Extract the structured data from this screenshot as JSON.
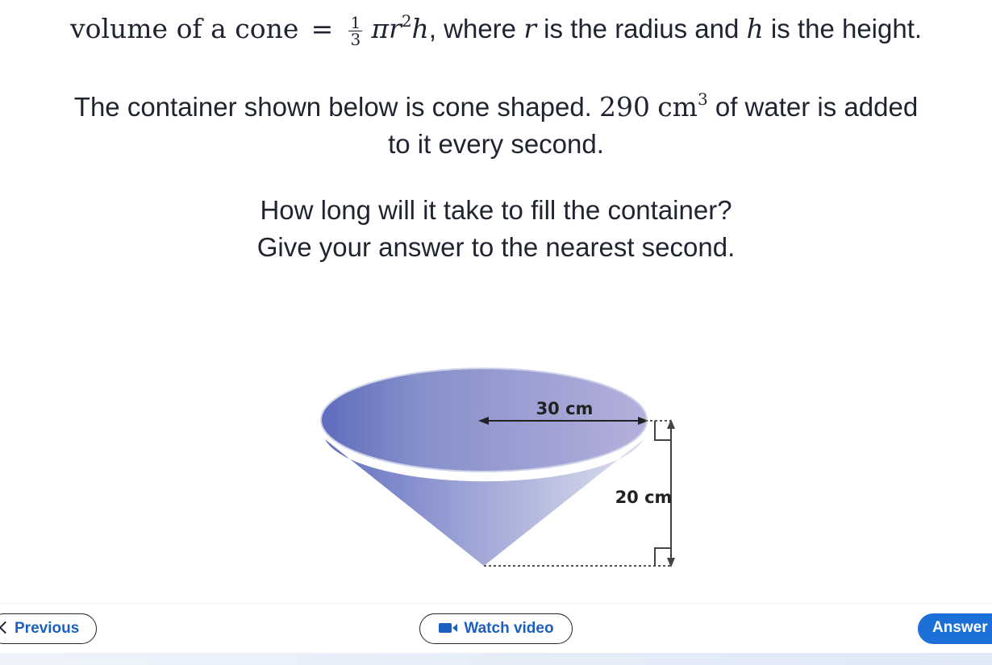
{
  "formula": {
    "prefix": "volume of a cone",
    "equals": "=",
    "frac_num": "1",
    "frac_den": "3",
    "expr": "πr",
    "exp": "2",
    "h": "h",
    "suffix_a": ", where ",
    "r": "r",
    "suffix_b": " is the radius and ",
    "h2": "h",
    "suffix_c": " is the height."
  },
  "problem": {
    "line1_a": "The container shown below is cone shaped. ",
    "rate_value": "290",
    "rate_unit": "cm",
    "rate_exp": "3",
    "line1_b": " of water is added",
    "line2": "to it every second.",
    "question1": "How long will it take to fill the container?",
    "question2": "Give your answer to the nearest second."
  },
  "diagram": {
    "radius_label": "30 cm",
    "height_label": "20 cm"
  },
  "nav": {
    "previous": "Previous",
    "watch_video": "Watch video",
    "answer": "Answer"
  },
  "colors": {
    "accent": "#1b6fd6",
    "link": "#1b5fc1",
    "cone_dark": "#6a76c4",
    "cone_light": "#d6dcec"
  }
}
